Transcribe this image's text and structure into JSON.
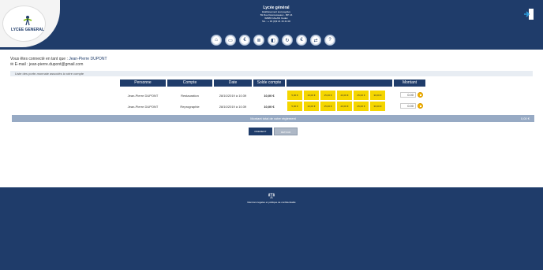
{
  "header": {
    "logo_text": "LYCEE GENERAL",
    "school_name": "Lycée général",
    "address_lines": [
      "Etablissement test payplus",
      "59 Rue Desrousseaux - BP 16",
      "62980 CALAIS Cedex",
      "Tel. : + 33 (0)3 21 16 41 00"
    ],
    "nav_icons": [
      {
        "name": "home-icon",
        "glyph": "⌂"
      },
      {
        "name": "credit-card-icon",
        "glyph": "▭"
      },
      {
        "name": "euro-icon",
        "glyph": "€"
      },
      {
        "name": "list-icon",
        "glyph": "≣"
      },
      {
        "name": "wallet-icon",
        "glyph": "◧"
      },
      {
        "name": "refresh-icon",
        "glyph": "↻"
      },
      {
        "name": "cash-icon",
        "glyph": "€"
      },
      {
        "name": "transfer-icon",
        "glyph": "⇄"
      },
      {
        "name": "help-icon",
        "glyph": "?"
      }
    ]
  },
  "user": {
    "connected_prefix": "Vous êtes connecté en tant que :",
    "name": "Jean-Pierre DUPONT",
    "email_label": "E-mail : jean-pierre.dupont@gmail.com"
  },
  "section": {
    "title": "Liste des porte-monnaie associés à votre compte"
  },
  "table": {
    "headers": [
      "Personne",
      "Compte",
      "Date",
      "Solde compte",
      "Montant"
    ],
    "rows": [
      {
        "person": "Jean-Pierre DUPONT",
        "account": "Restauration",
        "date": "28/10/2019 à 10:39",
        "balance": "10,00 €",
        "amounts": [
          "5,00 €",
          "10,00 €",
          "15,00 €",
          "20,00 €",
          "25,00 €",
          "30,00 €"
        ],
        "input_value": "0.00"
      },
      {
        "person": "Jean-Pierre DUPONT",
        "account": "Reprographie",
        "date": "28/10/2019 à 10:39",
        "balance": "10,00 €",
        "amounts": [
          "5,00 €",
          "10,00 €",
          "15,00 €",
          "20,00 €",
          "25,00 €",
          "30,00 €"
        ],
        "input_value": "0.00"
      }
    ]
  },
  "total": {
    "label": "Montant total de votre règlement",
    "value": "0,00 €"
  },
  "buttons": {
    "pay": "PAIEMENT",
    "back": "RETOUR"
  },
  "footer": {
    "text": "Mentions légales et politique de confidentialité"
  },
  "colors": {
    "primary": "#1f3c6a",
    "amount_button": "#f5d600",
    "total_bar": "#97aac4"
  }
}
